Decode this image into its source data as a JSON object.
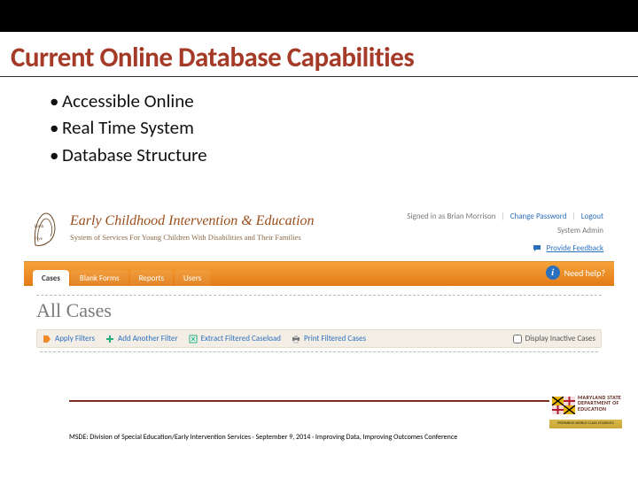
{
  "slide": {
    "title": "Current Online Database Capabilities",
    "bullets": [
      "Accessible Online",
      "Real Time System",
      "Database Structure"
    ],
    "footnote": "MSDE: Division of Special Education/Early Intervention Services · September 9, 2014 · Improving Data, Improving Outcomes Conference"
  },
  "app": {
    "brand_title": "Early Childhood Intervention",
    "brand_amp": "&",
    "brand_title2": "Education",
    "brand_sub": "System of Services For Young Children With Disabilities and Their Families",
    "signed_in_prefix": "Signed in as ",
    "signed_in_user": "Brian Morrison",
    "link_change_pw": "Change Password",
    "link_logout": "Logout",
    "sys_admin": "System Admin",
    "feedback": "Provide Feedback",
    "tabs": [
      "Cases",
      "Blank Forms",
      "Reports",
      "Users"
    ],
    "active_tab_index": 0,
    "help_label": "Need help?",
    "page_heading": "All Cases",
    "toolbar": {
      "apply_filters": "Apply Filters",
      "add_filter": "Add Another Filter",
      "extract": "Extract Filtered Caseload",
      "print": "Print Filtered Cases",
      "inactive": "Display Inactive Cases"
    }
  },
  "logo": {
    "dept_line1": "MARYLAND STATE",
    "dept_line2": "DEPARTMENT OF",
    "dept_line3": "EDUCATION",
    "strip": "PREPARING WORLD CLASS STUDENTS"
  },
  "colors": {
    "accent": "#a43a27",
    "tab_grad_top": "#f6a23a",
    "tab_grad_bot": "#e27a14"
  }
}
